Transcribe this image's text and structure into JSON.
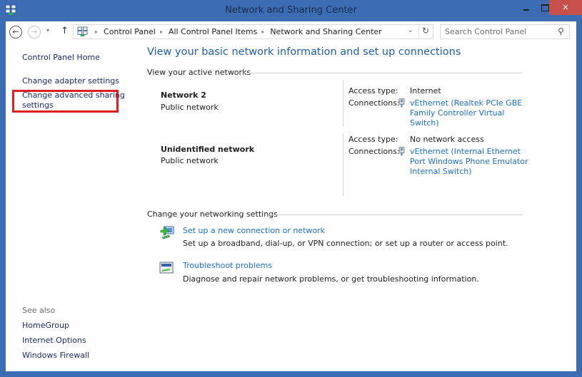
{
  "window": {
    "title": "Network and Sharing Center",
    "close_glyph": "×",
    "icon": "network-center-icon"
  },
  "navigation": {
    "back_glyph": "←",
    "forward_glyph": "→",
    "recent_glyph": "▾",
    "up_glyph": "↑",
    "breadcrumbs": [
      "Control Panel",
      "All Control Panel Items",
      "Network and Sharing Center"
    ],
    "separator_glyph": "▸",
    "dropdown_glyph": "⌄",
    "refresh_glyph": "↻",
    "search_placeholder": "Search Control Panel",
    "search_value": "",
    "search_glyph": "⚲"
  },
  "sidebar": {
    "home": "Control Panel Home",
    "tasks": [
      {
        "label": "Change adapter settings"
      },
      {
        "label": "Change advanced sharing",
        "label2": "settings",
        "highlighted": true
      }
    ],
    "see_also_title": "See also",
    "see_also": [
      "HomeGroup",
      "Internet Options",
      "Windows Firewall"
    ],
    "highlight_color": "#e02020"
  },
  "main": {
    "title": "View your basic network information and set up connections",
    "active_networks_heading": "View your active networks",
    "networks": [
      {
        "name": "Network  2",
        "type": "Public network",
        "access_label": "Access type:",
        "access_value": "Internet",
        "connections_label": "Connections:",
        "connection_link": "vEthernet (Realtek PCIe GBE Family Controller Virtual Switch)"
      },
      {
        "name": "Unidentified network",
        "type": "Public network",
        "access_label": "Access type:",
        "access_value": "No network access",
        "connections_label": "Connections:",
        "connection_link": "vEthernet (Internal Ethernet Port Windows Phone Emulator Internal Switch)"
      }
    ],
    "settings_heading": "Change your networking settings",
    "tasks": [
      {
        "link": "Set up a new connection or network",
        "description": "Set up a broadband, dial-up, or VPN connection; or set up a router or access point.",
        "icon": "new-connection-icon"
      },
      {
        "link": "Troubleshoot problems",
        "description": "Diagnose and repair network problems, or get troubleshooting information.",
        "icon": "troubleshoot-icon"
      }
    ]
  },
  "colors": {
    "window_frame": "#3c6db4",
    "link_blue": "#1e6fc8",
    "title_blue": "#1e5ea8",
    "sidebar_link": "#1c2a6a",
    "close_button": "#c7504c"
  }
}
